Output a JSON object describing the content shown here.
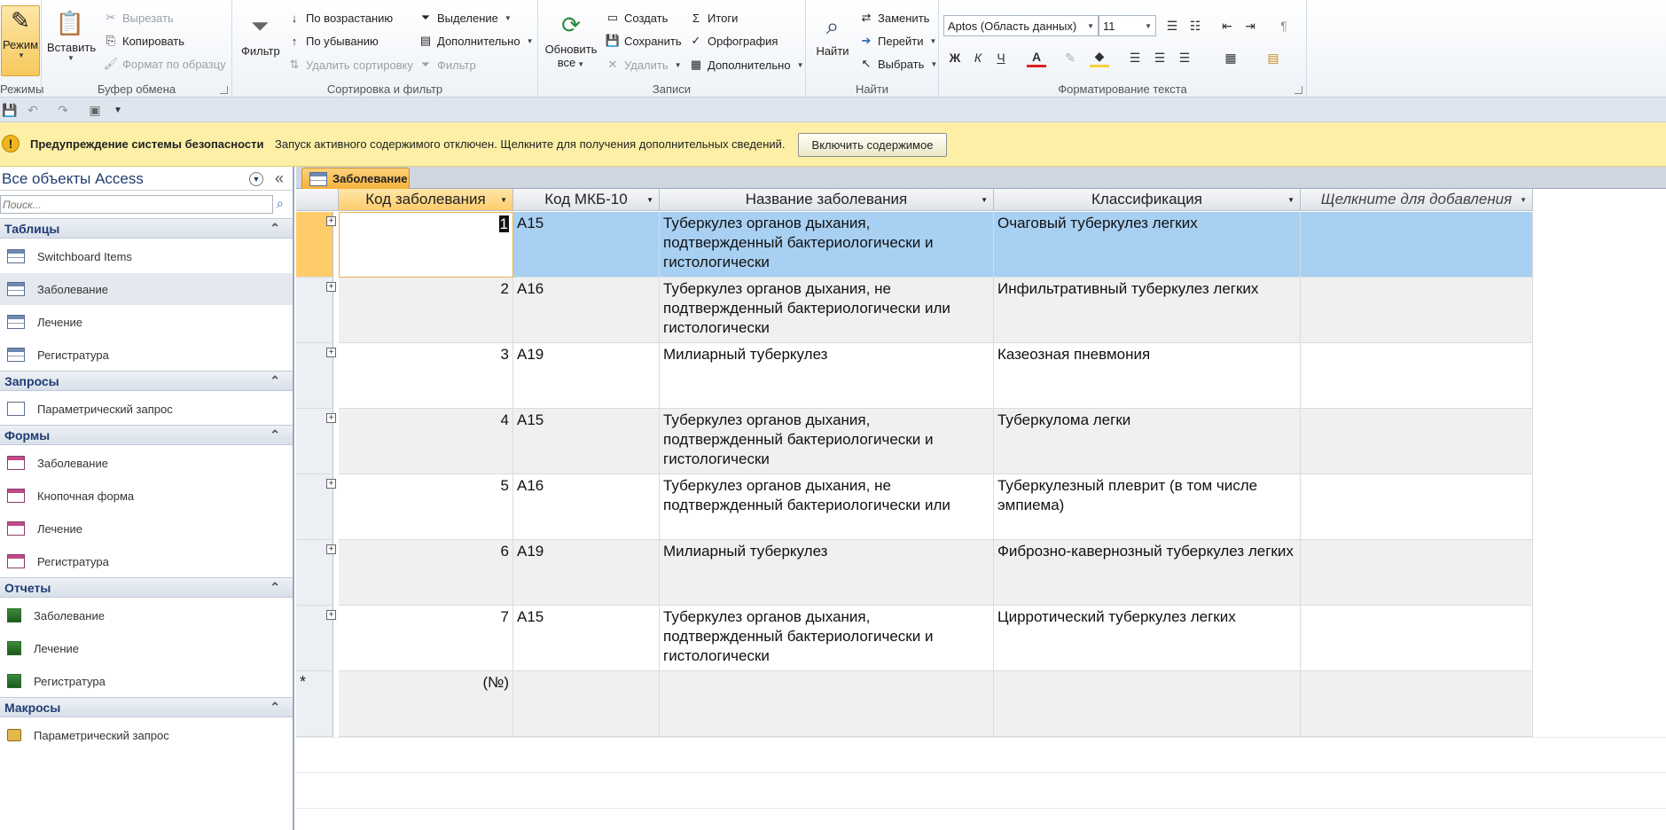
{
  "ribbon": {
    "groups": {
      "modes": {
        "title": "Режимы",
        "view_label": "Режим"
      },
      "clipboard": {
        "title": "Буфер обмена",
        "paste_label": "Вставить",
        "cut_label": "Вырезать",
        "copy_label": "Копировать",
        "format_painter_label": "Формат по образцу"
      },
      "sort_filter": {
        "title": "Сортировка и фильтр",
        "filter_label": "Фильтр",
        "ascending_label": "По возрастанию",
        "descending_label": "По убыванию",
        "remove_sort_label": "Удалить сортировку",
        "selection_label": "Выделение",
        "advanced_label": "Дополнительно",
        "toggle_filter_label": "Фильтр"
      },
      "records": {
        "title": "Записи",
        "refresh_label_1": "Обновить",
        "refresh_label_2": "все",
        "new_label": "Создать",
        "save_label": "Сохранить",
        "delete_label": "Удалить",
        "totals_label": "Итоги",
        "spelling_label": "Орфография",
        "more_label": "Дополнительно"
      },
      "find": {
        "title": "Найти",
        "find_label": "Найти",
        "replace_label": "Заменить",
        "goto_label": "Перейти",
        "select_label": "Выбрать"
      },
      "text_format": {
        "title": "Форматирование текста",
        "font_name": "Aptos (Область данных)",
        "font_size": "11",
        "bold": "Ж",
        "italic": "К",
        "underline": "Ч",
        "font_color_label": "A"
      }
    }
  },
  "security": {
    "title": "Предупреждение системы безопасности",
    "message": "Запуск активного содержимого отключен. Щелкните для получения дополнительных сведений.",
    "button_label": "Включить содержимое"
  },
  "nav": {
    "header": "Все объекты Access",
    "search_placeholder": "Поиск...",
    "sections": [
      {
        "title": "Таблицы",
        "items": [
          "Switchboard Items",
          "Заболевание",
          "Лечение",
          "Регистратура"
        ]
      },
      {
        "title": "Запросы",
        "items": [
          "Параметрический запрос"
        ]
      },
      {
        "title": "Формы",
        "items": [
          "Заболевание",
          "Кнопочная форма",
          "Лечение",
          "Регистратура"
        ]
      },
      {
        "title": "Отчеты",
        "items": [
          "Заболевание",
          "Лечение",
          "Регистратура"
        ]
      },
      {
        "title": "Макросы",
        "items": [
          "Параметрический запрос"
        ]
      }
    ]
  },
  "document": {
    "tab_label": "Заболевание",
    "columns": [
      "Код заболевания",
      "Код МКБ-10",
      "Название заболевания",
      "Классификация",
      "Щелкните для добавления"
    ],
    "rows": [
      {
        "id": "1",
        "mkb": "A15",
        "name": "Туберкулез органов дыхания, подтвержденный бактериологически и гистологически",
        "class": "Очаговый туберкулез легких"
      },
      {
        "id": "2",
        "mkb": "A16",
        "name": "Туберкулез органов дыхания, не подтвержденный бактериологически или гистологически",
        "class": "Инфильтративный туберкулез легких"
      },
      {
        "id": "3",
        "mkb": "A19",
        "name": "Милиарный туберкулез",
        "class": "Казеозная пневмония"
      },
      {
        "id": "4",
        "mkb": "A15",
        "name": "Туберкулез органов дыхания, подтвержденный бактериологически и гистологически",
        "class": "Туберкулома легки"
      },
      {
        "id": "5",
        "mkb": "A16",
        "name": "Туберкулез органов дыхания, не подтвержденный бактериологически или",
        "class": "Туберкулезный плеврит (в том числе эмпиема)"
      },
      {
        "id": "6",
        "mkb": "A19",
        "name": "Милиарный туберкулез",
        "class": "Фиброзно-кавернозный туберкулез легких"
      },
      {
        "id": "7",
        "mkb": "A15",
        "name": "Туберкулез органов дыхания, подтвержденный бактериологически и гистологически",
        "class": "Цирротический туберкулез легких"
      }
    ],
    "new_row": {
      "marker": "*",
      "id": "(№)"
    }
  },
  "colors": {
    "selected_row": "#a8d0f2",
    "tab_accent": "#f5b13b",
    "security_bar": "#fdf0a6",
    "nav_header": "#1f3c72"
  }
}
